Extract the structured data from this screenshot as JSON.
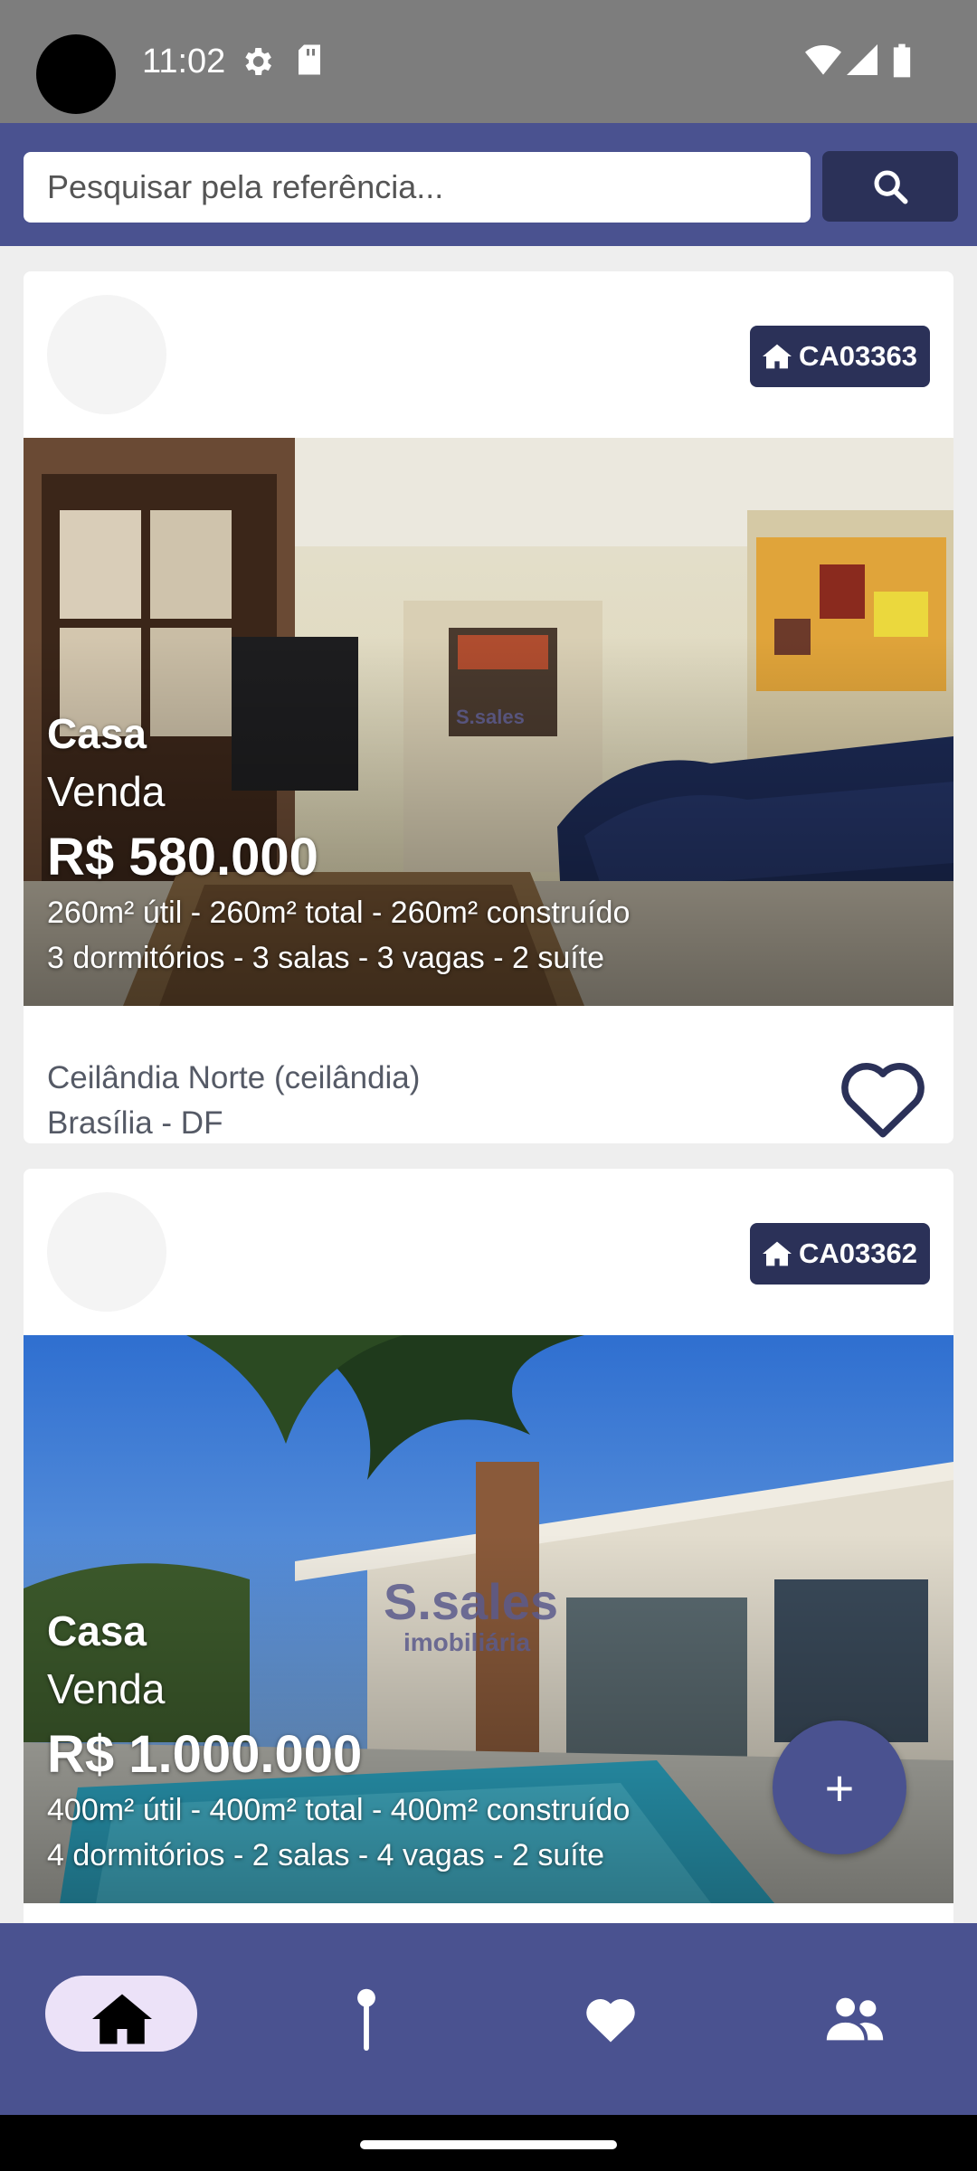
{
  "status_bar": {
    "time": "11:02",
    "icons": [
      "settings-icon",
      "sd-card-icon",
      "wifi-icon",
      "signal-icon",
      "battery-icon"
    ]
  },
  "search": {
    "placeholder": "Pesquisar pela referência...",
    "button_icon": "search-icon"
  },
  "listings": [
    {
      "reference": "CA03363",
      "type": "Casa",
      "deal": "Venda",
      "price": "R$ 580.000",
      "area": "260m² útil - 260m² total - 260m² construído",
      "rooms": "3 dormitórios - 3 salas - 3 vagas - 2 suíte",
      "neighborhood": "Ceilândia Norte (ceilândia)",
      "city": "Brasília - DF",
      "watermark": "S.sales"
    },
    {
      "reference": "CA03362",
      "type": "Casa",
      "deal": "Venda",
      "price": "R$ 1.000.000",
      "area": "400m² útil - 400m² total - 400m² construído",
      "rooms": "4 dormitórios - 2 salas - 4 vagas - 2 suíte",
      "watermark": "S.sales",
      "watermark_sub": "imobiliária"
    }
  ],
  "fab": {
    "label": "+"
  },
  "bottom_nav": [
    {
      "icon": "home-icon",
      "active": true
    },
    {
      "icon": "map-pin-icon",
      "active": false
    },
    {
      "icon": "heart-icon",
      "active": false
    },
    {
      "icon": "people-icon",
      "active": false
    }
  ],
  "colors": {
    "primary": "#4a5290",
    "dark": "#2b3158",
    "nav_active_pill": "#ece2f8"
  }
}
